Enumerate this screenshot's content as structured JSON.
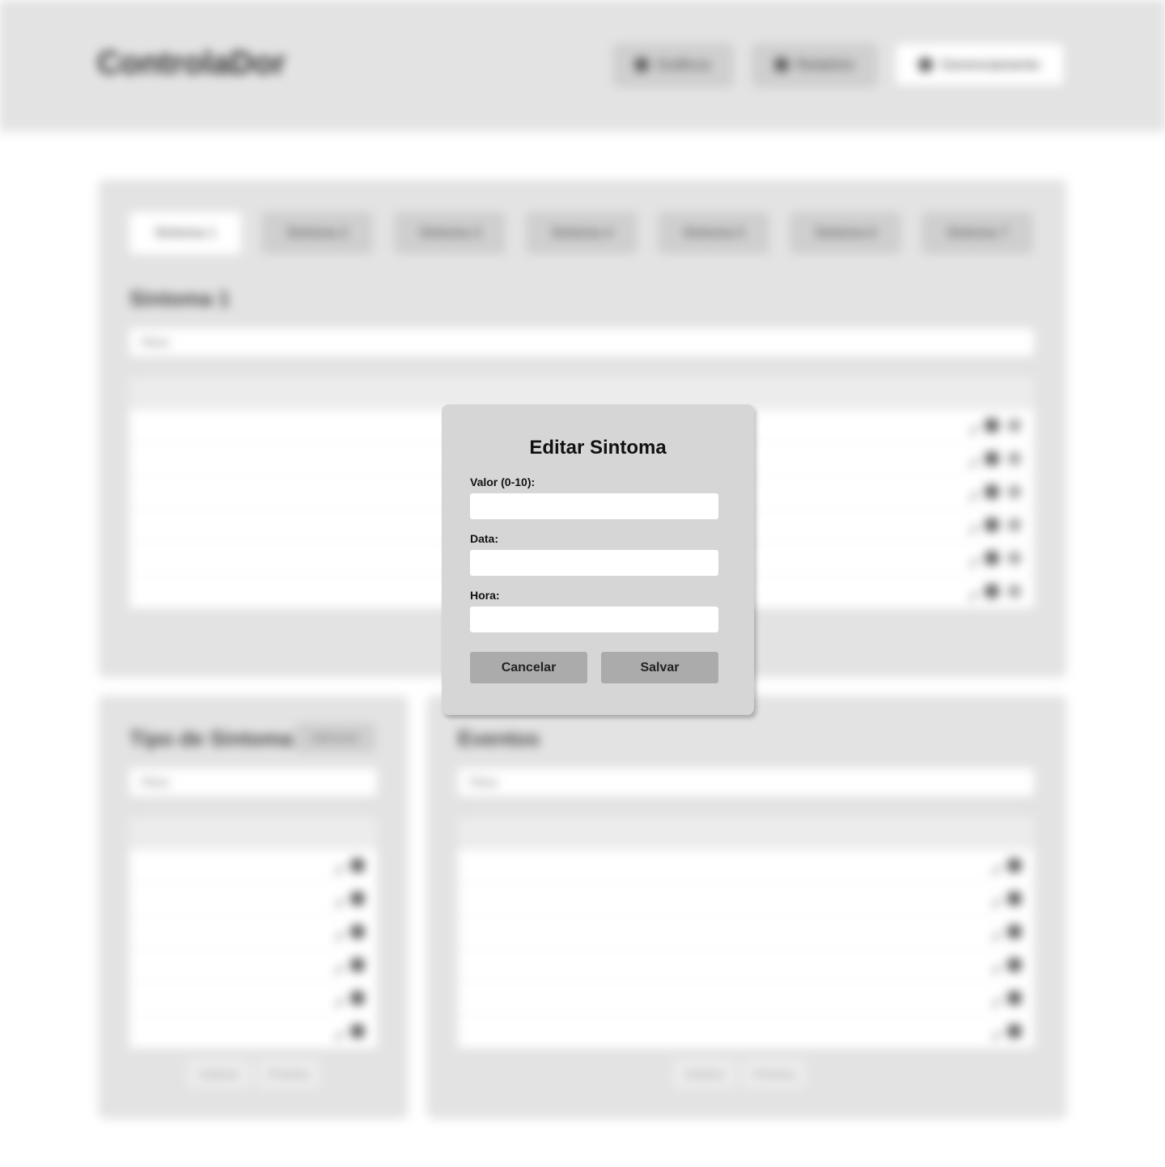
{
  "header": {
    "brand": "ControlaDor",
    "nav": [
      {
        "label": "Gráficos",
        "icon": "chart-icon"
      },
      {
        "label": "Relatório",
        "icon": "report-icon"
      },
      {
        "label": "Gerenciamento",
        "icon": "settings-icon"
      }
    ]
  },
  "symptoms": {
    "tabs": [
      "Sintoma 1",
      "Sintoma 2",
      "Sintoma 3",
      "Sintoma 4",
      "Sintoma 5",
      "Sintoma 6",
      "Sintoma 7"
    ],
    "title": "Sintoma 1",
    "search_placeholder": "Filtrar"
  },
  "symptom_types": {
    "title": "Tipo de Sintoma",
    "add_label": "Adicionar",
    "search_placeholder": "Filtrar",
    "prev_label": "Anterior",
    "next_label": "Próximo"
  },
  "events": {
    "title": "Eventos",
    "search_placeholder": "Filtrar",
    "prev_label": "Anterior",
    "next_label": "Próximo"
  },
  "modal": {
    "title": "Editar Sintoma",
    "value_label": "Valor (0-10):",
    "date_label": "Data:",
    "time_label": "Hora:",
    "value": "",
    "date": "",
    "time": "",
    "cancel_label": "Cancelar",
    "save_label": "Salvar"
  }
}
